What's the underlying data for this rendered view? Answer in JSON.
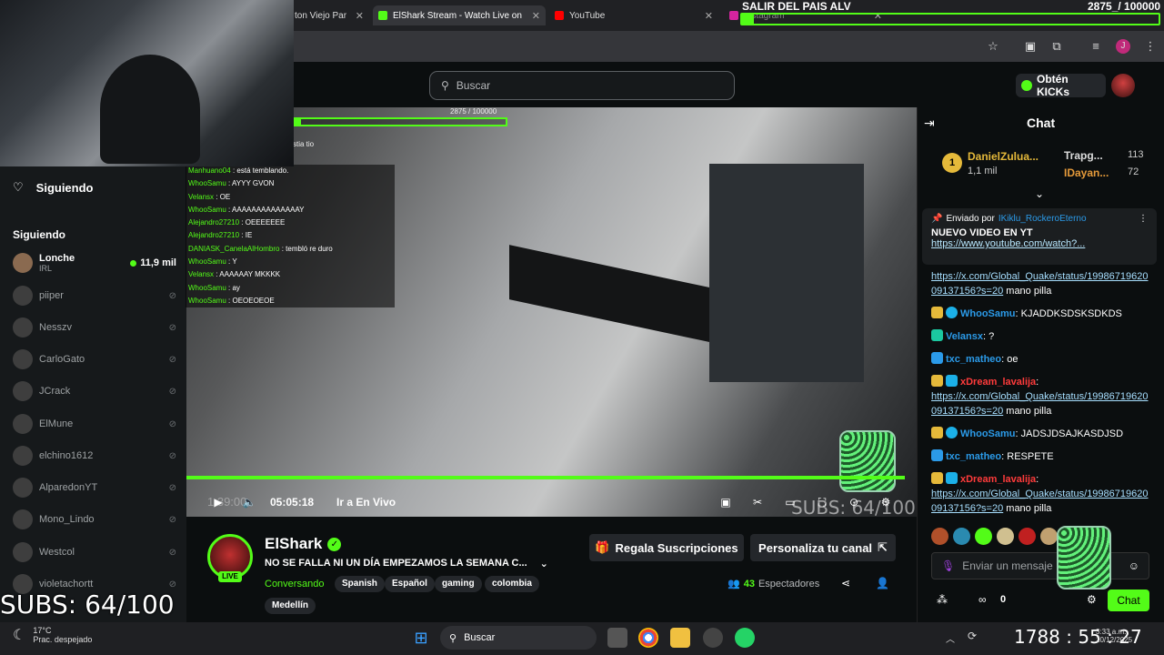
{
  "browser": {
    "tabs": [
      {
        "title": "ton Viejo Par"
      },
      {
        "title": "ElShark Stream - Watch Live on"
      },
      {
        "title": "YouTube"
      },
      {
        "title": "Instagram"
      }
    ]
  },
  "overlay": {
    "title": "SALIR DEL PAIS ALV",
    "counter": "2875_/ 100000",
    "mini_counter": "2875 / 100000",
    "subs_text": "SUBS: 64/100",
    "subs_text_video": "SUBS: 64/100",
    "progress_fraction": 0.029,
    "top_snippet": "stia tio",
    "chat": [
      {
        "user": "Manhuano04",
        "msg": "está temblando."
      },
      {
        "user": "WhooSamu",
        "msg": "AYYY GVON"
      },
      {
        "user": "Velansx",
        "msg": "OE"
      },
      {
        "user": "WhooSamu",
        "msg": "AAAAAAAAAAAAAAY"
      },
      {
        "user": "Alejandro27210",
        "msg": "OEEEEEEE"
      },
      {
        "user": "Alejandro27210",
        "msg": "IE"
      },
      {
        "user": "DANIASK_CanelaAlHombro",
        "msg": "tembló re duro"
      },
      {
        "user": "WhooSamu",
        "msg": "Y"
      },
      {
        "user": "Velansx",
        "msg": "AAAAAAY MKKKK"
      },
      {
        "user": "WhooSamu",
        "msg": "ay"
      },
      {
        "user": "WhooSamu",
        "msg": "OEOEOEOE"
      }
    ]
  },
  "header": {
    "search_placeholder": "Buscar",
    "kicks_label": "Obtén KICKs"
  },
  "sidebar": {
    "following_title": "Siguiendo",
    "following_subtitle": "Siguiendo",
    "channels": [
      {
        "name": "Lonche",
        "sub": "IRL",
        "viewers": "11,9 mil",
        "live": true
      },
      {
        "name": "piiper"
      },
      {
        "name": "Nesszv"
      },
      {
        "name": "CarloGato"
      },
      {
        "name": "JCrack"
      },
      {
        "name": "ElMune"
      },
      {
        "name": "elchino1612"
      },
      {
        "name": "AlparedonYT"
      },
      {
        "name": "Mono_Lindo"
      },
      {
        "name": "Westcol"
      },
      {
        "name": "violetachortt"
      }
    ]
  },
  "player": {
    "time": "05:05:18",
    "go_live": "Ir a En Vivo",
    "ghost_time": "1:39:00"
  },
  "channel": {
    "name": "ElShark",
    "live_badge": "LIVE",
    "title": "NO SE FALLA NI UN DÍA EMPEZAMOS LA SEMANA C...",
    "category": "Conversando",
    "tags": [
      "Spanish",
      "Español",
      "gaming",
      "colombia",
      "Medellín"
    ],
    "gift_button": "Regala Suscripciones",
    "customize_button": "Personaliza tu canal",
    "viewers": "43",
    "viewers_label": "Espectadores"
  },
  "chat": {
    "title": "Chat",
    "gifters": [
      {
        "rank": "1",
        "name": "DanielZulua...",
        "amount": "1,1 mil"
      },
      {
        "name": "Trapg...",
        "amount": "113"
      },
      {
        "name": "IDayan...",
        "amount": "72"
      }
    ],
    "pinned": {
      "label": "Enviado por",
      "user": "IKiklu_RockeroEterno",
      "text": "NUEVO VIDEO EN YT",
      "link": "https://www.youtube.com/watch?..."
    },
    "messages": [
      {
        "user": "",
        "text": "",
        "link": "https://x.com/Global_Quake/status/1998671962009137156?s=20",
        "after": " mano pilla",
        "color": "#ffffff"
      },
      {
        "user": "WhooSamu",
        "text": ": KJADDKSDSKSDKDS",
        "color": "#2b9ae8"
      },
      {
        "user": "Velansx",
        "text": ": ?",
        "color": "#2b9ae8"
      },
      {
        "user": "txc_matheo",
        "text": ": oe",
        "color": "#2b9ae8"
      },
      {
        "user": "xDream_lavalija",
        "text": ":",
        "link": "https://x.com/Global_Quake/status/1998671962009137156?s=20",
        "after": " mano pilla",
        "color": "#ff3b3b"
      },
      {
        "user": "WhooSamu",
        "text": ": JADSJDSAJKASDJSD",
        "color": "#2b9ae8"
      },
      {
        "user": "txc_matheo",
        "text": ": RESPETE",
        "color": "#2b9ae8"
      },
      {
        "user": "xDream_lavalija",
        "text": ":",
        "link": "https://x.com/Global_Quake/status/1998671962009137156?s=20",
        "after": " mano pilla",
        "color": "#ff3b3b"
      }
    ],
    "input_placeholder": "Enviar un mensaje",
    "kicks_count": "0",
    "send_label": "Chat"
  },
  "taskbar": {
    "temp": "17°C",
    "weather": "Prac. despejado",
    "search": "Buscar",
    "clock_overlay": "1788 : 55 : 27",
    "time": "3:33 a.m.",
    "date": "10/12/2025"
  },
  "colors": {
    "accent": "#53fc18",
    "background": "#0b0e0f"
  }
}
